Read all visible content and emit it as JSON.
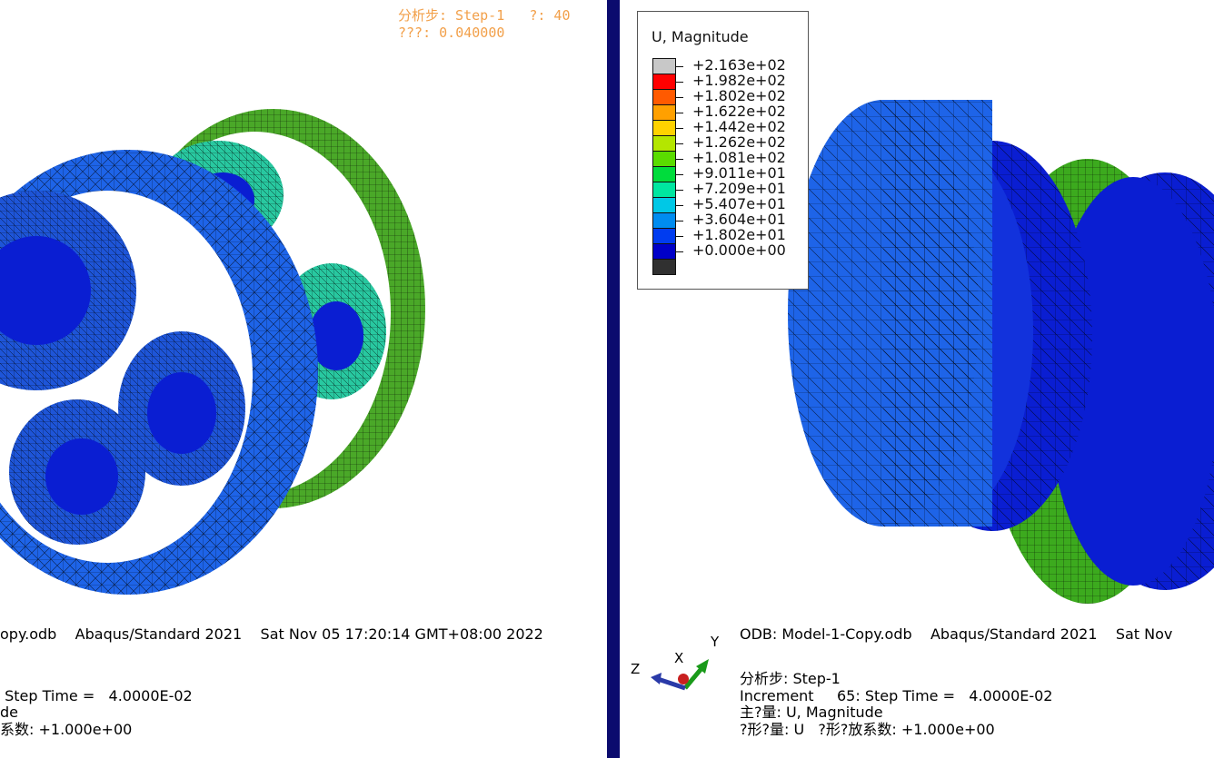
{
  "left_viewport": {
    "step_line1": "分析步: Step-1   ?: 40",
    "step_line2": "???: 0.040000",
    "odb_line": "opy.odb    Abaqus/Standard 2021    Sat Nov 05 17:20:14 GMT+08:00 2022",
    "info_line1": " Step Time =   4.0000E-02",
    "info_line2": "de",
    "info_line3": "系数: +1.000e+00"
  },
  "right_viewport": {
    "odb_line": "ODB: Model-1-Copy.odb    Abaqus/Standard 2021    Sat Nov",
    "info_line1": "分析步: Step-1",
    "info_line2": "Increment     65: Step Time =   4.0000E-02",
    "info_line3": "主?量: U, Magnitude",
    "info_line4": "?形?量: U   ?形?放系数: +1.000e+00"
  },
  "legend": {
    "title": "U, Magnitude",
    "entries": [
      {
        "label": "+2.163e+02",
        "color": "#c8c8c8"
      },
      {
        "label": "+1.982e+02",
        "color": "#ff0000"
      },
      {
        "label": "+1.802e+02",
        "color": "#ff5a00"
      },
      {
        "label": "+1.622e+02",
        "color": "#ffa000"
      },
      {
        "label": "+1.442e+02",
        "color": "#ffd200"
      },
      {
        "label": "+1.262e+02",
        "color": "#b4e600"
      },
      {
        "label": "+1.081e+02",
        "color": "#5adc00"
      },
      {
        "label": "+9.011e+01",
        "color": "#00dc3c"
      },
      {
        "label": "+7.209e+01",
        "color": "#00e6a0"
      },
      {
        "label": "+5.407e+01",
        "color": "#00c8e6"
      },
      {
        "label": "+3.604e+01",
        "color": "#008cf0"
      },
      {
        "label": "+1.802e+01",
        "color": "#003cf0"
      },
      {
        "label": "+0.000e+00",
        "color": "#0000c8"
      },
      {
        "label": "",
        "color": "#303030"
      }
    ]
  },
  "triad": {
    "x": "X",
    "y": "Y",
    "z": "Z"
  },
  "colors": {
    "mesh_blue": "#1e5fe6",
    "mesh_dark_blue": "#0a1ed2",
    "mesh_green": "#3caa1e",
    "divider": "#0b0b6e",
    "orange_text": "#f2a04a"
  }
}
